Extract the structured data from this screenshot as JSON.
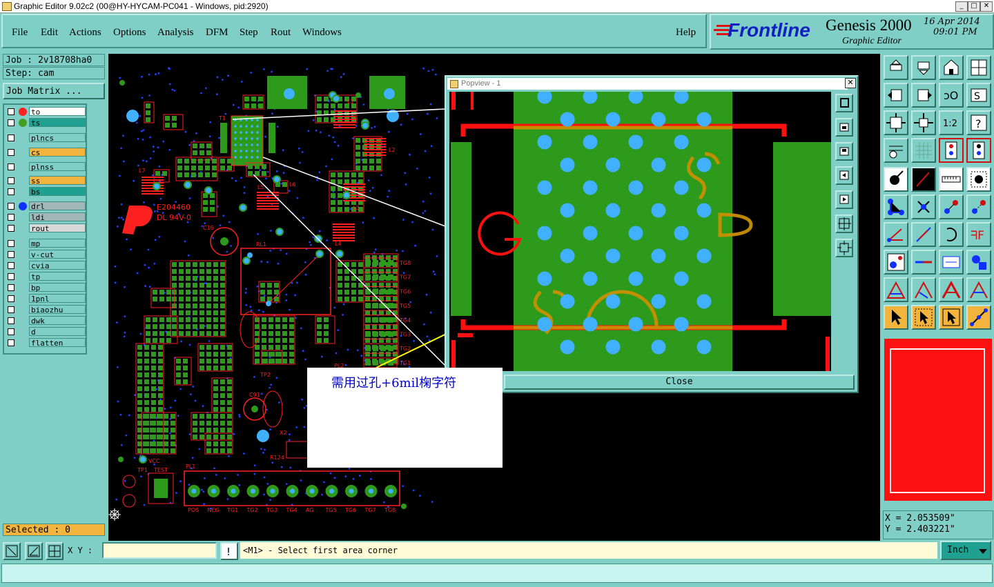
{
  "window": {
    "title": "Graphic Editor 9.02c2 (00@HY-HYCAM-PC041 - Windows, pid:2920)"
  },
  "menu": [
    "File",
    "Edit",
    "Actions",
    "Options",
    "Analysis",
    "DFM",
    "Step",
    "Rout",
    "Windows"
  ],
  "help_label": "Help",
  "logo": {
    "brand": "Frontline",
    "product": "Genesis 2000",
    "subtitle": "Graphic Editor",
    "date": "16 Apr 2014",
    "time": "09:01 PM"
  },
  "job": {
    "job_label": "Job : 2v18708ha0",
    "step_label": "Step: cam",
    "matrix_button": "Job Matrix ..."
  },
  "layers": [
    {
      "name": "to",
      "color": "#ffffff",
      "dot": "#ff2020"
    },
    {
      "name": "ts",
      "color": "#20a090",
      "dot": "#40a020"
    },
    {
      "name": "plncs",
      "color": "#7fcfc6",
      "dot": ""
    },
    {
      "name": "cs",
      "color": "#f2b43c",
      "dot": ""
    },
    {
      "name": "plnss",
      "color": "#7fcfc6",
      "dot": ""
    },
    {
      "name": "ss",
      "color": "#f2b43c",
      "dot": ""
    },
    {
      "name": "bs",
      "color": "#20a090",
      "dot": ""
    },
    {
      "name": "drl",
      "color": "#a0b8b8",
      "dot": "#1030ff"
    },
    {
      "name": "ldi",
      "color": "#a0b8b8",
      "dot": ""
    },
    {
      "name": "rout",
      "color": "#d8d8d8",
      "dot": ""
    },
    {
      "name": "mp",
      "color": "#7fcfc6",
      "dot": ""
    },
    {
      "name": "v-cut",
      "color": "#7fcfc6",
      "dot": ""
    },
    {
      "name": "cvia",
      "color": "#7fcfc6",
      "dot": ""
    },
    {
      "name": "tp",
      "color": "#7fcfc6",
      "dot": ""
    },
    {
      "name": "bp",
      "color": "#7fcfc6",
      "dot": ""
    },
    {
      "name": "1pnl",
      "color": "#7fcfc6",
      "dot": ""
    },
    {
      "name": "biaozhu",
      "color": "#7fcfc6",
      "dot": ""
    },
    {
      "name": "dwk",
      "color": "#7fcfc6",
      "dot": ""
    },
    {
      "name": "d",
      "color": "#7fcfc6",
      "dot": ""
    },
    {
      "name": "flatten",
      "color": "#7fcfc6",
      "dot": ""
    }
  ],
  "selected": "Selected : 0",
  "popview": {
    "title": "Popview - 1",
    "close_label": "Close"
  },
  "annotation": "需用过孔+6mil椈字符",
  "pcb_labels": {
    "e204": "E204460",
    "dl": "DL 94V-0",
    "t1": "T1",
    "l1": "L1",
    "l2": "L2",
    "l3": "L3",
    "l4": "L4",
    "l5": "L5",
    "l6": "L6",
    "l7": "L7",
    "c16": "C16",
    "rl1": "RL1",
    "pl1": "PL1",
    "pl2": "PL2",
    "test": "TEST",
    "vcc": "VCC",
    "tp1": "TP1",
    "tp2": "TP2",
    "x2": "X2",
    "r124": "R124",
    "c91": "C91",
    "tg_list": [
      "TG8",
      "TG7",
      "TG6",
      "TG5",
      "TG4",
      "TG3",
      "TG2",
      "TG1"
    ],
    "pl1_pins": [
      "POS",
      "NEG",
      "TG1",
      "TG2",
      "TG3",
      "TG4",
      "AG",
      "TG5",
      "TG6",
      "TG7",
      "TG8"
    ]
  },
  "coords": {
    "x": "X = 2.053509\"",
    "y": "Y = 2.403221\""
  },
  "xy_label": "X Y :",
  "xy_value": "",
  "prompt": "<M1> - Select first area corner",
  "units": "Inch",
  "colors": {
    "background": "#7fcfc6",
    "canvas": "#000000",
    "pad_green": "#2e9a1c",
    "copper_red": "#ff1010",
    "via_blue": "#40b0ff",
    "silk_orange": "#c09000"
  }
}
